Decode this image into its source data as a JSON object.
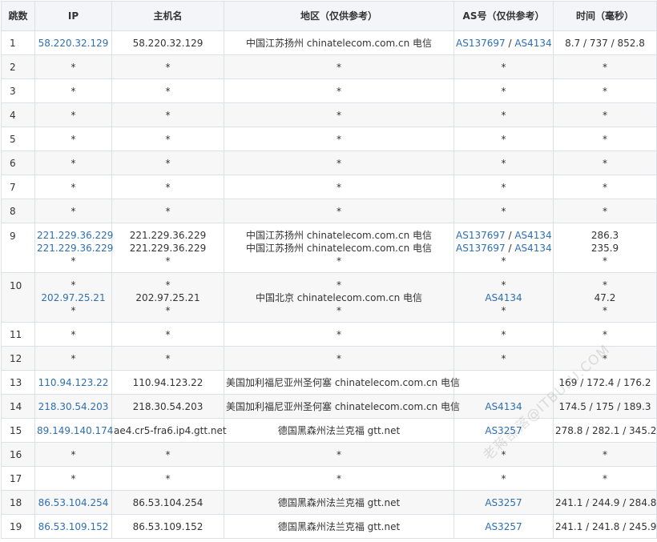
{
  "headers": {
    "hop": "跳数",
    "ip": "IP",
    "hostname": "主机名",
    "region": "地区（仅供参考）",
    "asn": "AS号（仅供参考）",
    "time": "时间（毫秒）"
  },
  "rows": [
    {
      "hop": "1",
      "ip": [
        "58.220.32.129"
      ],
      "host": [
        "58.220.32.129"
      ],
      "region": [
        "中国江苏扬州 chinatelecom.com.cn 电信"
      ],
      "as": [
        [
          "AS137697",
          "AS4134"
        ]
      ],
      "time": [
        "8.7 / 737 / 852.8"
      ]
    },
    {
      "hop": "2",
      "ip": [
        "*"
      ],
      "host": [
        "*"
      ],
      "region": [
        "*"
      ],
      "as": [
        [
          "*"
        ]
      ],
      "time": [
        "*"
      ]
    },
    {
      "hop": "3",
      "ip": [
        "*"
      ],
      "host": [
        "*"
      ],
      "region": [
        "*"
      ],
      "as": [
        [
          "*"
        ]
      ],
      "time": [
        "*"
      ]
    },
    {
      "hop": "4",
      "ip": [
        "*"
      ],
      "host": [
        "*"
      ],
      "region": [
        "*"
      ],
      "as": [
        [
          "*"
        ]
      ],
      "time": [
        "*"
      ]
    },
    {
      "hop": "5",
      "ip": [
        "*"
      ],
      "host": [
        "*"
      ],
      "region": [
        "*"
      ],
      "as": [
        [
          "*"
        ]
      ],
      "time": [
        "*"
      ]
    },
    {
      "hop": "6",
      "ip": [
        "*"
      ],
      "host": [
        "*"
      ],
      "region": [
        "*"
      ],
      "as": [
        [
          "*"
        ]
      ],
      "time": [
        "*"
      ]
    },
    {
      "hop": "7",
      "ip": [
        "*"
      ],
      "host": [
        "*"
      ],
      "region": [
        "*"
      ],
      "as": [
        [
          "*"
        ]
      ],
      "time": [
        "*"
      ]
    },
    {
      "hop": "8",
      "ip": [
        "*"
      ],
      "host": [
        "*"
      ],
      "region": [
        "*"
      ],
      "as": [
        [
          "*"
        ]
      ],
      "time": [
        "*"
      ]
    },
    {
      "hop": "9",
      "ip": [
        "221.229.36.229",
        "221.229.36.229",
        "*"
      ],
      "host": [
        "221.229.36.229",
        "221.229.36.229",
        "*"
      ],
      "region": [
        "中国江苏扬州 chinatelecom.com.cn 电信",
        "中国江苏扬州 chinatelecom.com.cn 电信",
        "*"
      ],
      "as": [
        [
          "AS137697",
          "AS4134"
        ],
        [
          "AS137697",
          "AS4134"
        ],
        [
          "*"
        ]
      ],
      "time": [
        "286.3",
        "235.9",
        "*"
      ]
    },
    {
      "hop": "10",
      "ip": [
        "*",
        "202.97.25.21",
        "*"
      ],
      "host": [
        "*",
        "202.97.25.21",
        "*"
      ],
      "region": [
        "*",
        "中国北京 chinatelecom.com.cn 电信",
        "*"
      ],
      "as": [
        [
          "*"
        ],
        [
          "AS4134"
        ],
        [
          "*"
        ]
      ],
      "time": [
        "*",
        "47.2",
        "*"
      ]
    },
    {
      "hop": "11",
      "ip": [
        "*"
      ],
      "host": [
        "*"
      ],
      "region": [
        "*"
      ],
      "as": [
        [
          "*"
        ]
      ],
      "time": [
        "*"
      ]
    },
    {
      "hop": "12",
      "ip": [
        "*"
      ],
      "host": [
        "*"
      ],
      "region": [
        "*"
      ],
      "as": [
        [
          "*"
        ]
      ],
      "time": [
        "*"
      ]
    },
    {
      "hop": "13",
      "ip": [
        "110.94.123.22"
      ],
      "host": [
        "110.94.123.22"
      ],
      "region": [
        "美国加利福尼亚州圣何塞 chinatelecom.com.cn 电信"
      ],
      "as": [
        []
      ],
      "time": [
        "169 / 172.4 / 176.2"
      ]
    },
    {
      "hop": "14",
      "ip": [
        "218.30.54.203"
      ],
      "host": [
        "218.30.54.203"
      ],
      "region": [
        "美国加利福尼亚州圣何塞 chinatelecom.com.cn 电信"
      ],
      "as": [
        [
          "AS4134"
        ]
      ],
      "time": [
        "174.5 / 175 / 189.3"
      ]
    },
    {
      "hop": "15",
      "ip": [
        "89.149.140.174"
      ],
      "host": [
        "ae4.cr5-fra6.ip4.gtt.net"
      ],
      "region": [
        "德国黑森州法兰克福 gtt.net"
      ],
      "as": [
        [
          "AS3257"
        ]
      ],
      "time": [
        "278.8 / 282.1 / 345.2"
      ]
    },
    {
      "hop": "16",
      "ip": [
        "*"
      ],
      "host": [
        "*"
      ],
      "region": [
        "*"
      ],
      "as": [
        [
          "*"
        ]
      ],
      "time": [
        "*"
      ]
    },
    {
      "hop": "17",
      "ip": [
        "*"
      ],
      "host": [
        "*"
      ],
      "region": [
        "*"
      ],
      "as": [
        [
          "*"
        ]
      ],
      "time": [
        "*"
      ]
    },
    {
      "hop": "18",
      "ip": [
        "86.53.104.254"
      ],
      "host": [
        "86.53.104.254"
      ],
      "region": [
        "德国黑森州法兰克福 gtt.net"
      ],
      "as": [
        [
          "AS3257"
        ]
      ],
      "time": [
        "241.1 / 244.9 / 284.8"
      ]
    },
    {
      "hop": "19",
      "ip": [
        "86.53.109.152"
      ],
      "host": [
        "86.53.109.152"
      ],
      "region": [
        "德国黑森州法兰克福 gtt.net"
      ],
      "as": [
        [
          "AS3257"
        ]
      ],
      "time": [
        "241.1 / 241.8 / 245.9"
      ]
    }
  ],
  "watermark": "老蒋部落@ITBULU.COM",
  "colors": {
    "link": "#2e6fb0",
    "header_bg": "#f3f5f8",
    "stripe": "#f7f7f7",
    "border": "#dcdfe6"
  }
}
